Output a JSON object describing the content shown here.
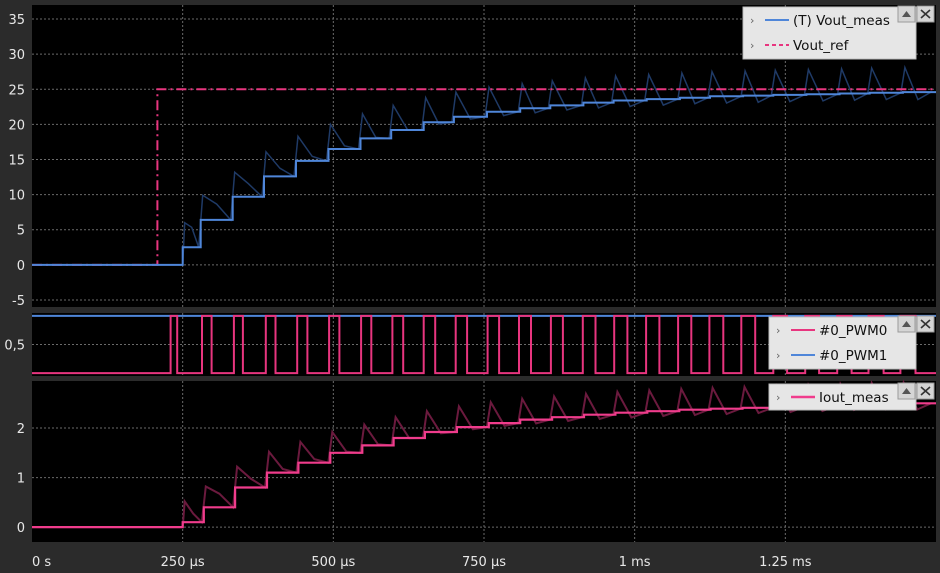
{
  "x_axis": {
    "tick_labels": [
      "0 s",
      "250 µs",
      "500 µs",
      "750 µs",
      "1 ms",
      "1.25 ms"
    ],
    "range_us": [
      0,
      1500
    ]
  },
  "panels": [
    {
      "legend": [
        {
          "label": "(T) Vout_meas"
        },
        {
          "label": "Vout_ref"
        }
      ]
    },
    {
      "legend": [
        {
          "label": "#0_PWM0"
        },
        {
          "label": "#0_PWM1"
        }
      ]
    },
    {
      "legend": [
        {
          "label": "Iout_meas"
        }
      ]
    }
  ],
  "chart_data": [
    {
      "type": "line",
      "ylim": [
        -6,
        37
      ],
      "yticks": [
        "-5",
        "0",
        "5",
        "10",
        "15",
        "20",
        "25",
        "30",
        "35"
      ],
      "series": [
        {
          "name": "(T) Vout_meas",
          "color": "#4f86d9",
          "style": "steps",
          "x_us": [
            0,
            250,
            280,
            333,
            385,
            438,
            492,
            545,
            596,
            650,
            700,
            755,
            810,
            860,
            915,
            965,
            1020,
            1075,
            1125,
            1180,
            1230,
            1285,
            1340,
            1390,
            1445,
            1495
          ],
          "y": [
            0,
            2.5,
            6.4,
            9.7,
            12.6,
            14.8,
            16.5,
            18.0,
            19.2,
            20.3,
            21.1,
            21.8,
            22.3,
            22.7,
            23.1,
            23.4,
            23.6,
            23.8,
            24.0,
            24.1,
            24.2,
            24.3,
            24.4,
            24.5,
            24.6,
            24.6
          ]
        },
        {
          "name": "Vout_ref",
          "color": "#e8357f",
          "style": "dashdot",
          "x_us": [
            0,
            208,
            208,
            1500
          ],
          "y": [
            0,
            0,
            25,
            25
          ]
        }
      ]
    },
    {
      "type": "line",
      "ylim": [
        -0.05,
        1.05
      ],
      "yticks": [
        "0,5"
      ],
      "series": [
        {
          "name": "#0_PWM0",
          "color": "#e8357f",
          "style": "pulses",
          "pulses_us": [
            [
              230,
              241
            ],
            [
              282,
              298
            ],
            [
              335,
              350
            ],
            [
              388,
              404
            ],
            [
              440,
              457
            ],
            [
              493,
              510
            ],
            [
              546,
              563
            ],
            [
              598,
              616
            ],
            [
              650,
              669
            ],
            [
              703,
              722
            ],
            [
              756,
              775
            ],
            [
              808,
              828
            ],
            [
              861,
              881
            ],
            [
              914,
              935
            ],
            [
              966,
              988
            ],
            [
              1019,
              1041
            ],
            [
              1072,
              1094
            ],
            [
              1124,
              1147
            ],
            [
              1177,
              1200
            ],
            [
              1230,
              1253
            ],
            [
              1283,
              1306
            ],
            [
              1336,
              1360
            ],
            [
              1388,
              1413
            ],
            [
              1441,
              1466
            ]
          ]
        },
        {
          "name": "#0_PWM1",
          "color": "#4f86d9",
          "style": "steps",
          "x_us": [
            0,
            1500
          ],
          "y": [
            1,
            1
          ]
        }
      ]
    },
    {
      "type": "line",
      "ylim": [
        -0.3,
        2.95
      ],
      "yticks": [
        "0",
        "1",
        "2"
      ],
      "series": [
        {
          "name": "Iout_meas",
          "color": "#f03c8c",
          "style": "steps",
          "x_us": [
            0,
            250,
            285,
            337,
            390,
            442,
            495,
            548,
            600,
            652,
            705,
            758,
            810,
            863,
            916,
            968,
            1021,
            1074,
            1126,
            1179,
            1232,
            1285,
            1338,
            1390,
            1443,
            1495
          ],
          "y": [
            0,
            0.1,
            0.4,
            0.8,
            1.1,
            1.3,
            1.5,
            1.65,
            1.8,
            1.92,
            2.02,
            2.1,
            2.17,
            2.22,
            2.27,
            2.31,
            2.34,
            2.37,
            2.39,
            2.41,
            2.43,
            2.45,
            2.47,
            2.49,
            2.5,
            2.5
          ]
        }
      ]
    }
  ]
}
